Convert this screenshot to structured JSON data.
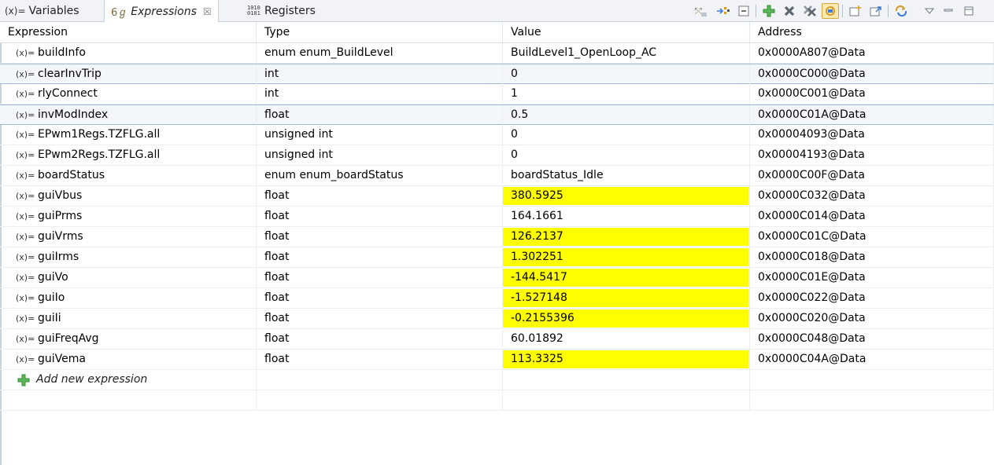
{
  "tabs": [
    {
      "label": "Variables",
      "icon": "(x)=",
      "active": false
    },
    {
      "label": "Expressions",
      "icon": "6ℊ",
      "active": true,
      "close": "☒"
    },
    {
      "label": "Registers",
      "icon": "1010\n0101",
      "active": false
    }
  ],
  "toolbar": {
    "icons": [
      "show-type-names-icon",
      "collapse-all-icon",
      "collapse-icon",
      "add-expression-icon",
      "remove-icon",
      "remove-all-icon",
      "refresh-icon",
      "import-icon",
      "export-icon",
      "continuous-refresh-icon",
      "view-menu-icon",
      "minimize-icon",
      "maximize-icon"
    ],
    "colors": {
      "add": "#3aa63a",
      "remove": "#6b7480",
      "active_bg": "#fbe9b0"
    }
  },
  "columns": [
    "Expression",
    "Type",
    "Value",
    "Address"
  ],
  "var_icon": "(x)=",
  "rows": [
    {
      "expr": "buildInfo",
      "type": "enum enum_BuildLevel",
      "value": "BuildLevel1_OpenLoop_AC",
      "address": "0x0000A807@Data",
      "highlight": false
    },
    {
      "expr": "clearInvTrip",
      "type": "int",
      "value": "0",
      "address": "0x0000C000@Data",
      "highlight": false
    },
    {
      "expr": "rlyConnect",
      "type": "int",
      "value": "1",
      "address": "0x0000C001@Data",
      "highlight": false
    },
    {
      "expr": "invModIndex",
      "type": "float",
      "value": "0.5",
      "address": "0x0000C01A@Data",
      "highlight": false
    },
    {
      "expr": "EPwm1Regs.TZFLG.all",
      "type": "unsigned int",
      "value": "0",
      "address": "0x00004093@Data",
      "highlight": false
    },
    {
      "expr": "EPwm2Regs.TZFLG.all",
      "type": "unsigned int",
      "value": "0",
      "address": "0x00004193@Data",
      "highlight": false
    },
    {
      "expr": "boardStatus",
      "type": "enum enum_boardStatus",
      "value": "boardStatus_Idle",
      "address": "0x0000C00F@Data",
      "highlight": false
    },
    {
      "expr": "guiVbus",
      "type": "float",
      "value": "380.5925",
      "address": "0x0000C032@Data",
      "highlight": true
    },
    {
      "expr": "guiPrms",
      "type": "float",
      "value": "164.1661",
      "address": "0x0000C014@Data",
      "highlight": false
    },
    {
      "expr": "guiVrms",
      "type": "float",
      "value": "126.2137",
      "address": "0x0000C01C@Data",
      "highlight": true
    },
    {
      "expr": "guiIrms",
      "type": "float",
      "value": "1.302251",
      "address": "0x0000C018@Data",
      "highlight": true
    },
    {
      "expr": "guiVo",
      "type": "float",
      "value": "-144.5417",
      "address": "0x0000C01E@Data",
      "highlight": true
    },
    {
      "expr": "guiIo",
      "type": "float",
      "value": "-1.527148",
      "address": "0x0000C022@Data",
      "highlight": true
    },
    {
      "expr": "guiIi",
      "type": "float",
      "value": "-0.2155396",
      "address": "0x0000C020@Data",
      "highlight": true
    },
    {
      "expr": "guiFreqAvg",
      "type": "float",
      "value": "60.01892",
      "address": "0x0000C048@Data",
      "highlight": false
    },
    {
      "expr": "guiVema",
      "type": "float",
      "value": "113.3325",
      "address": "0x0000C04A@Data",
      "highlight": true
    }
  ],
  "add_row_label": "Add new expression",
  "highlight_color": "#ffff00"
}
